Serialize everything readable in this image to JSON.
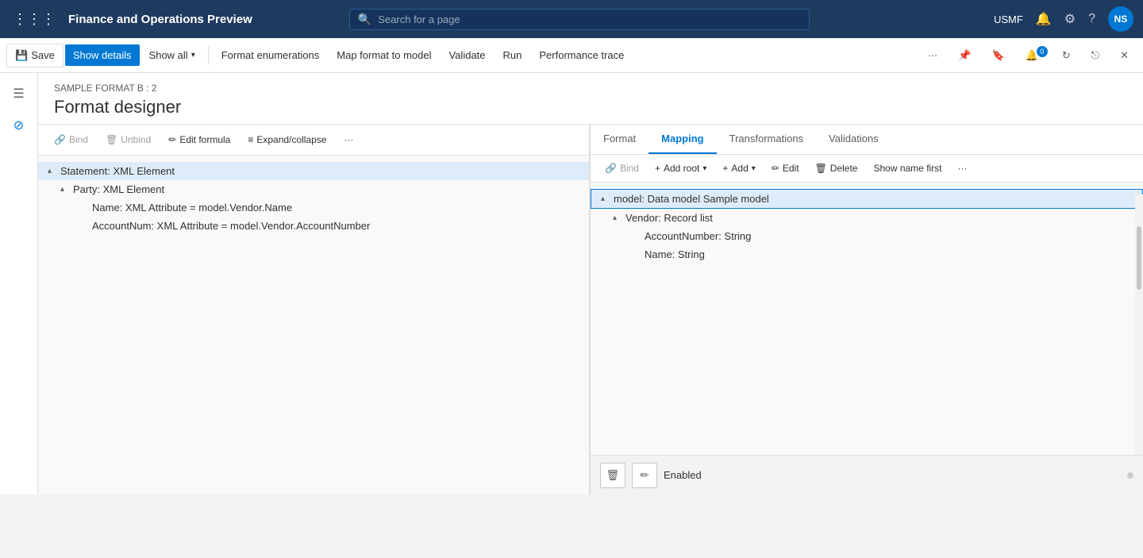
{
  "app": {
    "title": "Finance and Operations Preview",
    "waffle_icon": "⋮⋮⋮"
  },
  "search": {
    "placeholder": "Search for a page"
  },
  "topbar": {
    "region": "USMF",
    "avatar": "NS",
    "notification_count": "0"
  },
  "toolbar": {
    "save_label": "Save",
    "show_details_label": "Show details",
    "show_all_label": "Show all",
    "format_enumerations_label": "Format enumerations",
    "map_format_to_model_label": "Map format to model",
    "validate_label": "Validate",
    "run_label": "Run",
    "performance_trace_label": "Performance trace"
  },
  "sidebar_icons": [
    {
      "name": "home-icon",
      "glyph": "⌂"
    },
    {
      "name": "favorites-icon",
      "glyph": "☆"
    },
    {
      "name": "recent-icon",
      "glyph": "◷"
    },
    {
      "name": "workspaces-icon",
      "glyph": "⊞"
    },
    {
      "name": "modules-icon",
      "glyph": "☰"
    }
  ],
  "page": {
    "breadcrumb": "SAMPLE FORMAT B : 2",
    "title": "Format designer"
  },
  "left_panel": {
    "toolbar_items": [
      {
        "label": "Bind",
        "icon": "🔗",
        "disabled": false
      },
      {
        "label": "Unbind",
        "icon": "🗑",
        "disabled": false
      },
      {
        "label": "Edit formula",
        "icon": "✏",
        "disabled": false
      },
      {
        "label": "Expand/collapse",
        "icon": "≡",
        "disabled": false
      }
    ],
    "more_label": "···",
    "tree": [
      {
        "id": 1,
        "level": 0,
        "arrow": "▴",
        "label": "Statement: XML Element",
        "selected": true
      },
      {
        "id": 2,
        "level": 1,
        "arrow": "▴",
        "label": "Party: XML Element",
        "selected": false
      },
      {
        "id": 3,
        "level": 2,
        "arrow": "",
        "label": "Name: XML Attribute = model.Vendor.Name",
        "selected": false
      },
      {
        "id": 4,
        "level": 2,
        "arrow": "",
        "label": "AccountNum: XML Attribute = model.Vendor.AccountNumber",
        "selected": false
      }
    ]
  },
  "right_panel": {
    "tabs": [
      {
        "label": "Format",
        "active": false
      },
      {
        "label": "Mapping",
        "active": true
      },
      {
        "label": "Transformations",
        "active": false
      },
      {
        "label": "Validations",
        "active": false
      }
    ],
    "toolbar_items": [
      {
        "label": "Bind",
        "icon": "🔗",
        "disabled": false
      },
      {
        "label": "Add root",
        "icon": "+",
        "has_dropdown": true
      },
      {
        "label": "Add",
        "icon": "+",
        "has_dropdown": true
      },
      {
        "label": "Edit",
        "icon": "✏",
        "disabled": false
      },
      {
        "label": "Delete",
        "icon": "🗑",
        "disabled": false
      },
      {
        "label": "Show name first",
        "disabled": false
      }
    ],
    "more_label": "···",
    "tree": [
      {
        "id": 1,
        "level": 0,
        "arrow": "▴",
        "label": "model: Data model Sample model",
        "selected": true
      },
      {
        "id": 2,
        "level": 1,
        "arrow": "▴",
        "label": "Vendor: Record list",
        "selected": false
      },
      {
        "id": 3,
        "level": 2,
        "arrow": "",
        "label": "AccountNumber: String",
        "selected": false
      },
      {
        "id": 4,
        "level": 2,
        "arrow": "",
        "label": "Name: String",
        "selected": false
      }
    ]
  },
  "bottom_bar": {
    "status": "Enabled",
    "delete_icon": "🗑",
    "edit_icon": "✏"
  }
}
